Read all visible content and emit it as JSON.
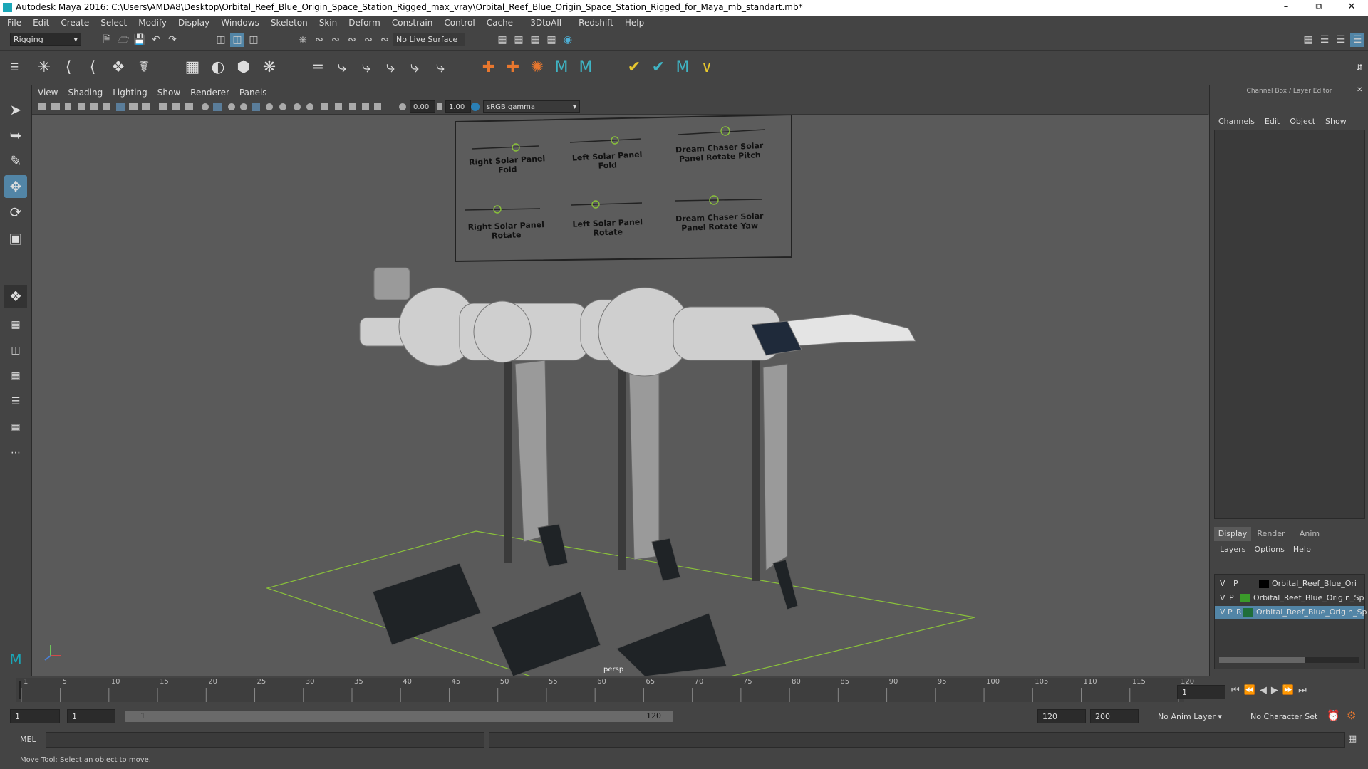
{
  "window": {
    "title": "Autodesk Maya 2016: C:\\Users\\AMDA8\\Desktop\\Orbital_Reef_Blue_Origin_Space_Station_Rigged_max_vray\\Orbital_Reef_Blue_Origin_Space_Station_Rigged_for_Maya_mb_standart.mb*"
  },
  "menu": [
    "File",
    "Edit",
    "Create",
    "Select",
    "Modify",
    "Display",
    "Windows",
    "Skeleton",
    "Skin",
    "Deform",
    "Constrain",
    "Control",
    "Cache",
    "- 3DtoAll -",
    "Redshift",
    "Help"
  ],
  "statusline": {
    "mode": "Rigging",
    "live_surface": "No Live Surface"
  },
  "viewport": {
    "menu": [
      "View",
      "Shading",
      "Lighting",
      "Show",
      "Renderer",
      "Panels"
    ],
    "exposure": "0.00",
    "gamma": "1.00",
    "colorspace": "sRGB gamma",
    "camera_label": "persp",
    "controls": [
      "Right Solar Panel Fold",
      "Left Solar Panel Fold",
      "Dream Chaser Solar Panel Rotate Pitch",
      "Right Solar Panel Rotate",
      "Left Solar Panel Rotate",
      "Dream Chaser Solar Panel Rotate Yaw"
    ]
  },
  "channelbox": {
    "title": "Channel Box / Layer Editor",
    "menu": [
      "Channels",
      "Edit",
      "Object",
      "Show"
    ],
    "tabs": [
      "Display",
      "Render",
      "Anim"
    ],
    "layer_menu": [
      "Layers",
      "Options",
      "Help"
    ],
    "layers": [
      {
        "v": "V",
        "p": "P",
        "r": "",
        "name": "Orbital_Reef_Blue_Ori",
        "color": "#000000"
      },
      {
        "v": "V",
        "p": "P",
        "r": "",
        "name": "Orbital_Reef_Blue_Origin_Sp",
        "color": "#3a9a2a"
      },
      {
        "v": "V",
        "p": "P",
        "r": "R",
        "name": "Orbital_Reef_Blue_Origin_Sp",
        "color": "#1f6e3a"
      }
    ]
  },
  "timeline": {
    "ticks": [
      "1",
      "5",
      "10",
      "15",
      "20",
      "25",
      "30",
      "35",
      "40",
      "45",
      "50",
      "55",
      "60",
      "65",
      "70",
      "75",
      "80",
      "85",
      "90",
      "95",
      "100",
      "105",
      "110",
      "115",
      "120"
    ],
    "current_frame": "1"
  },
  "range": {
    "start": "1",
    "start2": "1",
    "slider_start": "1",
    "slider_end": "120",
    "end": "120",
    "end2": "200",
    "anim_layer": "No Anim Layer",
    "character_set": "No Character Set"
  },
  "cmdline": {
    "label": "MEL"
  },
  "help": {
    "text": "Move Tool: Select an object to move."
  }
}
